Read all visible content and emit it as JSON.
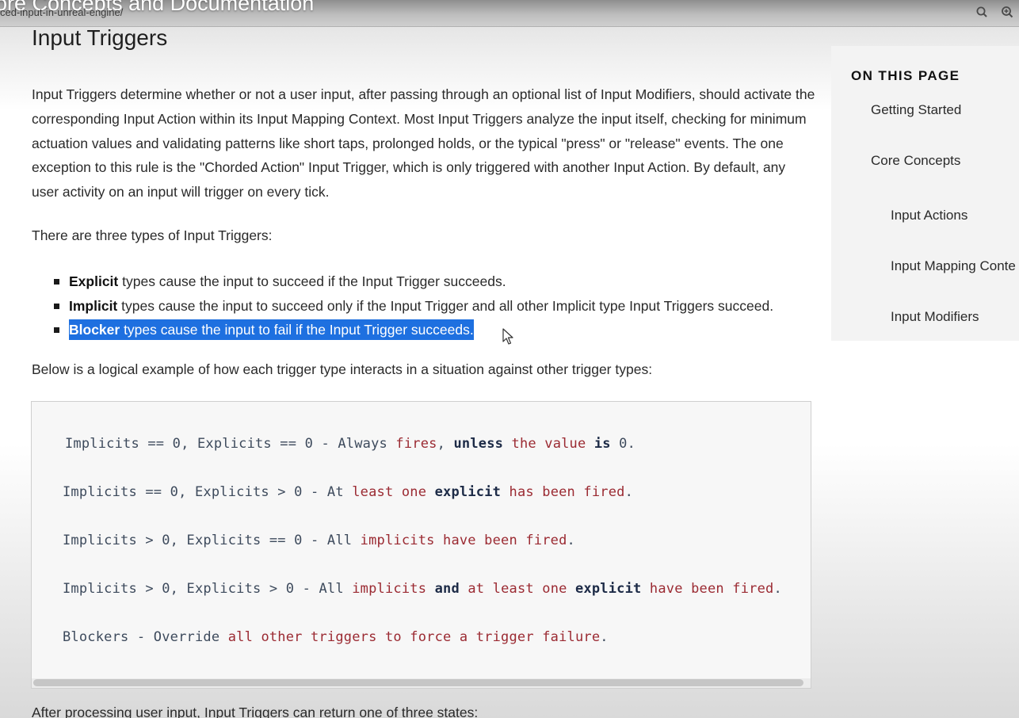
{
  "overlay": {
    "video_title": "ore Concepts and Documentation",
    "url": "ced-input-in-unreal-engine/",
    "search_icon": "search-icon",
    "zoom_icon": "zoom-in-icon"
  },
  "article": {
    "heading": "Input Triggers",
    "intro": "Input Triggers determine whether or not a user input, after passing through an optional list of Input Modifiers, should activate the corresponding Input Action within its Input Mapping Context. Most Input Triggers analyze the input itself, checking for minimum actuation values and validating patterns like short taps, prolonged holds, or the typical \"press\" or \"release\" events. The one exception to this rule is the \"Chorded Action\" Input Trigger, which is only triggered with another Input Action. By default, any user activity on an input will trigger on every tick.",
    "types_intro": "There are three types of Input Triggers:",
    "bullets": [
      {
        "term": "Explicit",
        "text": " types cause the input to succeed if the Input Trigger succeeds."
      },
      {
        "term": "Implicit",
        "text": " types cause the input to succeed only if the Input Trigger and all other Implicit type Input Triggers succeed."
      },
      {
        "term": "Blocker",
        "text": " types cause the input to fail if the Input Trigger succeeds."
      }
    ],
    "example_intro": "Below is a logical example of how each trigger type interacts in a situation against other trigger types:",
    "code_lines": [
      [
        {
          "t": "Implicits == 0, Explicits == 0 - Always ",
          "c": "p"
        },
        {
          "t": "fires",
          "c": "s"
        },
        {
          "t": ", ",
          "c": "p"
        },
        {
          "t": "unless",
          "c": "k"
        },
        {
          "t": " ",
          "c": "p"
        },
        {
          "t": "the value",
          "c": "s"
        },
        {
          "t": " ",
          "c": "p"
        },
        {
          "t": "is",
          "c": "k"
        },
        {
          "t": " 0.",
          "c": "p"
        }
      ],
      [
        {
          "t": "Implicits == 0, Explicits > 0 - At ",
          "c": "p"
        },
        {
          "t": "least one",
          "c": "s"
        },
        {
          "t": " ",
          "c": "p"
        },
        {
          "t": "explicit",
          "c": "k"
        },
        {
          "t": " ",
          "c": "p"
        },
        {
          "t": "has been fired",
          "c": "s"
        },
        {
          "t": ".",
          "c": "p"
        }
      ],
      [
        {
          "t": "Implicits > 0, Explicits == 0 - All ",
          "c": "p"
        },
        {
          "t": "implicits have been fired",
          "c": "s"
        },
        {
          "t": ".",
          "c": "p"
        }
      ],
      [
        {
          "t": "Implicits > 0, Explicits > 0 - All ",
          "c": "p"
        },
        {
          "t": "implicits",
          "c": "s"
        },
        {
          "t": " ",
          "c": "p"
        },
        {
          "t": "and",
          "c": "k"
        },
        {
          "t": " ",
          "c": "p"
        },
        {
          "t": "at least one",
          "c": "s"
        },
        {
          "t": " ",
          "c": "p"
        },
        {
          "t": "explicit",
          "c": "k"
        },
        {
          "t": " ",
          "c": "p"
        },
        {
          "t": "have been fired",
          "c": "s"
        },
        {
          "t": ".",
          "c": "p"
        }
      ],
      [
        {
          "t": "Blockers - Override ",
          "c": "p"
        },
        {
          "t": "all other triggers to force a trigger failure",
          "c": "s"
        },
        {
          "t": ".",
          "c": "p"
        }
      ]
    ],
    "after_code": "After processing user input, Input Triggers can return one of three states:"
  },
  "toc": {
    "heading": "ON THIS PAGE",
    "items": [
      "Getting Started",
      "Core Concepts",
      "Input Actions",
      "Input Mapping Conte",
      "Input Modifiers"
    ]
  },
  "colors": {
    "selection": "#1e70e0",
    "code_keyword": "#1d2b47",
    "code_string": "#9b2a32",
    "code_plain": "#3d4a5c"
  }
}
